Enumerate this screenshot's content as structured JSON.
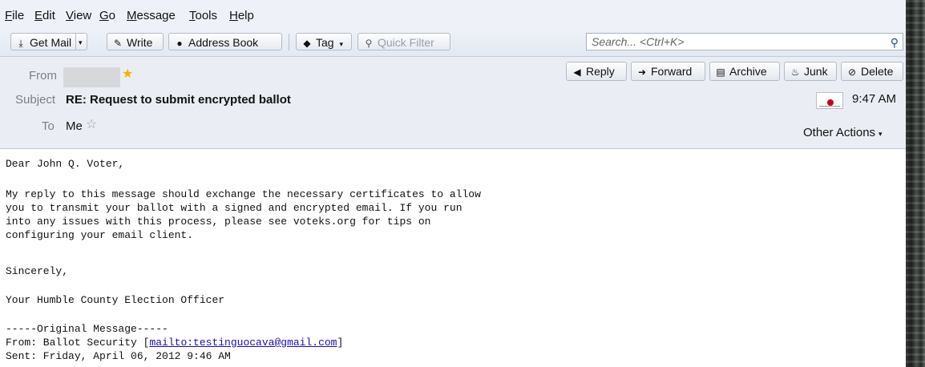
{
  "menu": {
    "items": [
      {
        "label": "File",
        "accel": "F",
        "rest": "ile"
      },
      {
        "label": "Edit",
        "accel": "E",
        "rest": "dit"
      },
      {
        "label": "View",
        "accel": "V",
        "rest": "iew"
      },
      {
        "label": "Go",
        "accel": "G",
        "rest": "o"
      },
      {
        "label": "Message",
        "accel": "M",
        "rest": "essage"
      },
      {
        "label": "Tools",
        "accel": "T",
        "rest": "ools"
      },
      {
        "label": "Help",
        "accel": "H",
        "rest": "elp"
      }
    ]
  },
  "toolbar": {
    "get_mail": "Get Mail",
    "write": "Write",
    "address_book": "Address Book",
    "tag": "Tag",
    "quick_filter": "Quick Filter",
    "search_placeholder": "Search... <Ctrl+K>"
  },
  "header": {
    "from_label": "From",
    "subject_label": "Subject",
    "subject": "RE: Request to submit encrypted ballot",
    "to_label": "To",
    "to": "Me",
    "time": "9:47 AM",
    "other_actions": "Other Actions",
    "actions": {
      "reply": "Reply",
      "forward": "Forward",
      "archive": "Archive",
      "junk": "Junk",
      "delete": "Delete"
    }
  },
  "body": {
    "lines": [
      "Dear John Q. Voter,",
      "",
      "My reply to this message should exchange the necessary certificates to allow",
      "you to transmit your ballot with a signed and encrypted email. If you run",
      "into any issues with this process, please see voteks.org for tips on",
      "configuring your email client.",
      "",
      "Sincerely,",
      "",
      "Your Humble County Election Officer",
      "",
      "-----Original Message-----"
    ],
    "from_prefix": "From: Ballot Security [",
    "from_link": "mailto:testinguocava@gmail.com",
    "from_suffix": "]",
    "sent": "Sent: Friday, April 06, 2012 9:46 AM"
  }
}
